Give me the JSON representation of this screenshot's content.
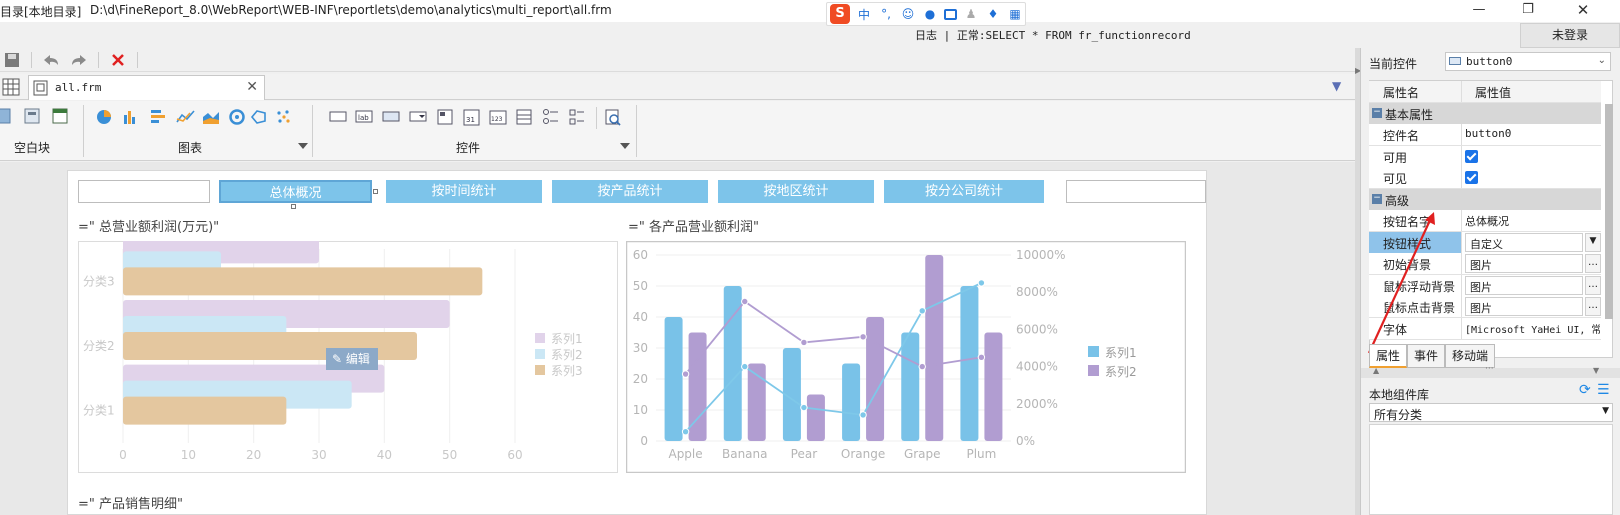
{
  "window": {
    "title": "目录[本地目录]",
    "path": "D:\\d\\FineReport_8.0\\WebReport\\WEB-INF\\reportlets\\demo\\analytics\\multi_report\\all.frm",
    "ime_label": "中",
    "ime_punct": "°,",
    "status": "日志 | 正常:SELECT * FROM fr_functionrecord",
    "login": "未登录"
  },
  "tab": {
    "file": "all.frm"
  },
  "palette": {
    "groups": [
      "空白块",
      "图表",
      "控件"
    ]
  },
  "report": {
    "nav": [
      "总体概况",
      "按时间统计",
      "按产品统计",
      "按地区统计",
      "按分公司统计"
    ],
    "edit_label": "编辑",
    "bottom_title": "=\"  产品销售明细\""
  },
  "chart_data": [
    {
      "type": "bar",
      "orientation": "horizontal",
      "title": "=\"  总营业额利润(万元)\"",
      "categories": [
        "分类1",
        "分类2",
        "分类3"
      ],
      "series": [
        {
          "name": "系列1",
          "values": [
            40,
            50,
            30
          ],
          "color": "#e1d3ea"
        },
        {
          "name": "系列2",
          "values": [
            35,
            25,
            15
          ],
          "color": "#cbe7f5"
        },
        {
          "name": "系列3",
          "values": [
            25,
            45,
            55
          ],
          "color": "#e4c79f"
        }
      ],
      "xlim": [
        0,
        60
      ],
      "xticks": [
        0,
        10,
        20,
        30,
        40,
        50,
        60
      ],
      "legend": "right"
    },
    {
      "type": "bar",
      "title": "=\"  各产品营业额利润\"",
      "categories": [
        "Apple",
        "Banana",
        "Pear",
        "Orange",
        "Grape",
        "Plum"
      ],
      "series": [
        {
          "name": "系列1",
          "values": [
            40,
            50,
            30,
            25,
            35,
            50
          ],
          "color": "#79c2e8"
        },
        {
          "name": "系列2",
          "values": [
            35,
            25,
            15,
            40,
            60,
            35
          ],
          "color": "#b19dd1"
        }
      ],
      "lines": [
        {
          "values": [
            500,
            4000,
            1800,
            1400,
            7000,
            8500
          ],
          "axis": "right",
          "color": "#7ec8e9"
        },
        {
          "values": [
            3600,
            7500,
            5300,
            5600,
            4000,
            4500
          ],
          "axis": "right",
          "color": "#b19dd1"
        }
      ],
      "ylim": [
        0,
        60
      ],
      "yticks": [
        0,
        10,
        20,
        30,
        40,
        50,
        60
      ],
      "y2lim": [
        0,
        10000
      ],
      "y2ticks": [
        "0%",
        "2000%",
        "4000%",
        "6000%",
        "8000%",
        "10000%"
      ],
      "legend": "right"
    }
  ],
  "panel": {
    "current_label": "当前控件",
    "current_value": "button0",
    "col_name": "属性名",
    "col_value": "属性值",
    "sections": {
      "basic": "基本属性",
      "advanced": "高级"
    },
    "rows": {
      "widget_name_k": "控件名",
      "widget_name_v": "button0",
      "enabled_k": "可用",
      "visible_k": "可见",
      "btn_name_k": "按钮名字",
      "btn_name_v": "总体概况",
      "btn_style_k": "按钮样式",
      "btn_style_v": "自定义",
      "init_bg_k": "初始背景",
      "init_bg_v": "图片",
      "hover_bg_k": "鼠标浮动背景",
      "hover_bg_v": "图片",
      "click_bg_k": "鼠标点击背景",
      "click_bg_v": "图片",
      "font_k": "字体",
      "font_v": "[Microsoft YaHei UI, 常"
    },
    "tabs": [
      "属性",
      "事件",
      "移动端"
    ],
    "library_title": "本地组件库",
    "category": "所有分类"
  }
}
